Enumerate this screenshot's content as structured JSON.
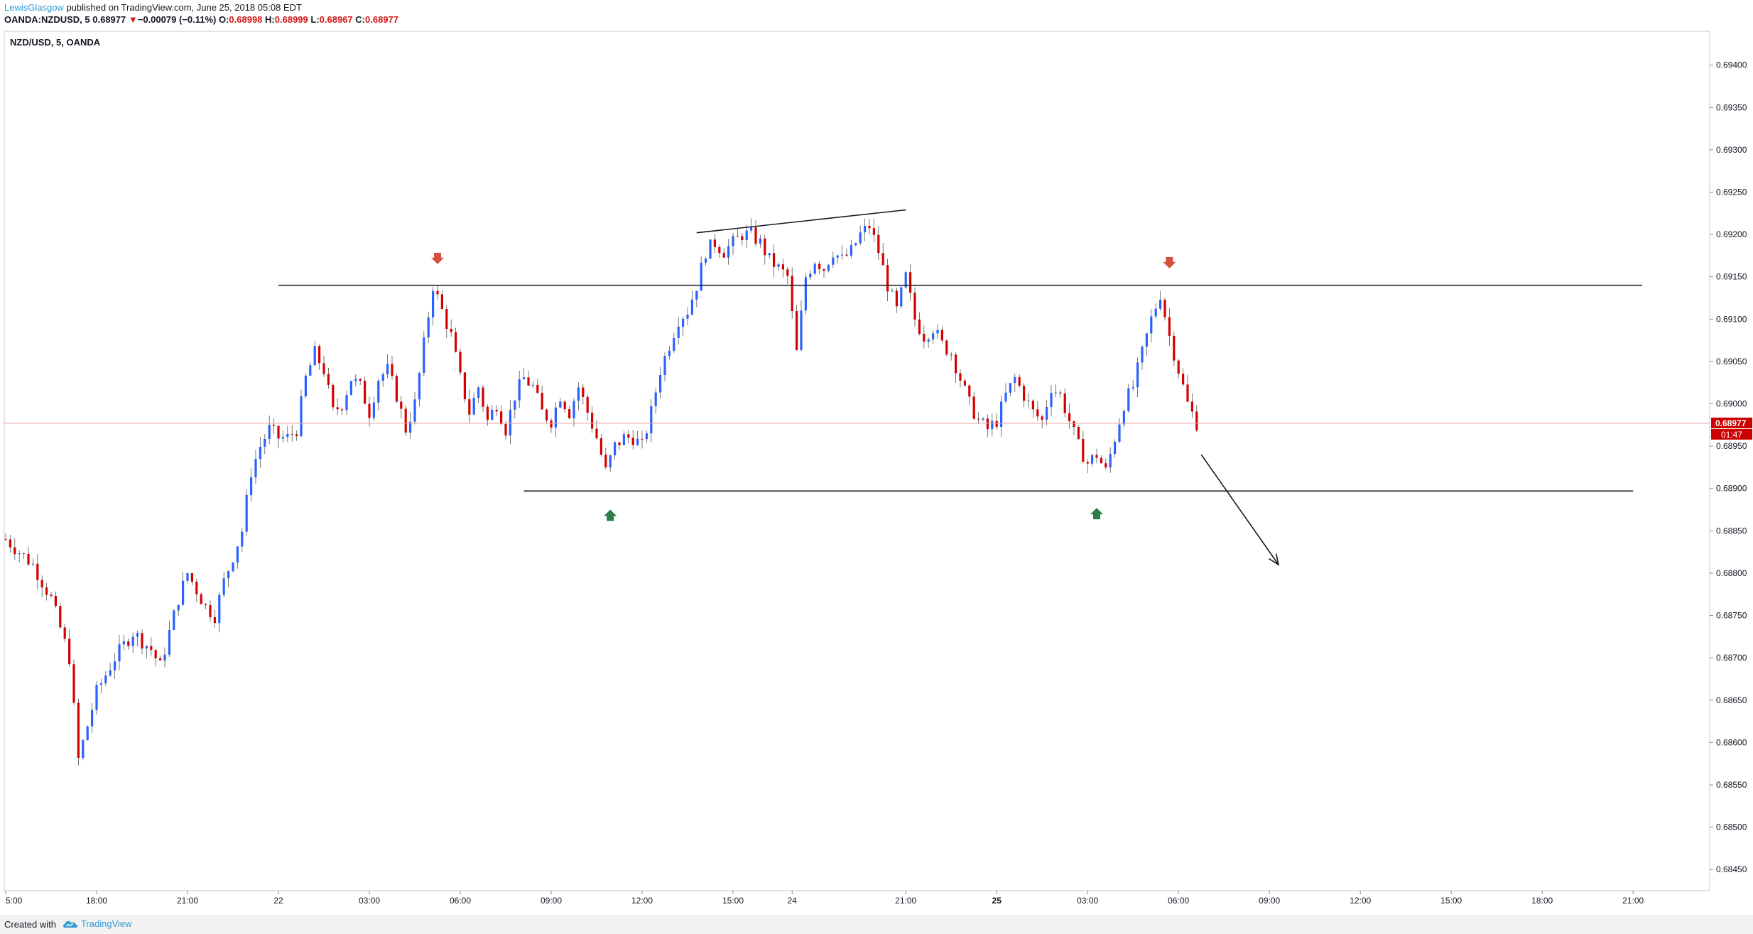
{
  "header": {
    "author": "LewisGlasgow",
    "published": " published on TradingView.com, June 25, 2018 05:08 EDT",
    "symbol": "OANDA:NZDUSD, 5",
    "last": "0.68977",
    "change_arrow": "▼",
    "change": "−0.00079 (−0.11%)",
    "o_label": "O:",
    "o": "0.68998",
    "h_label": "H:",
    "h": "0.68999",
    "l_label": "L:",
    "l": "0.68967",
    "c_label": "C:",
    "c": "0.68977"
  },
  "chart_title": "NZD/USD, 5, OANDA",
  "price_badge": {
    "price": "0.68977",
    "countdown": "01:47",
    "color": "#cc0000"
  },
  "colors": {
    "up": "#2962ff",
    "down": "#d50000",
    "axis": "#131722",
    "annotation_down": "#d1523c",
    "annotation_up": "#2e7d4a"
  },
  "footer": {
    "created_with": "Created with",
    "brand": "TradingView",
    "brand_icon": "tradingview-cloud-icon"
  },
  "chart_data": {
    "type": "candlestick",
    "y_axis": {
      "ylim": [
        0.68425,
        0.6944
      ],
      "ticks": [
        "0.69400",
        "0.69350",
        "0.69300",
        "0.69250",
        "0.69200",
        "0.69150",
        "0.69100",
        "0.69050",
        "0.69000",
        "0.68950",
        "0.68900",
        "0.68850",
        "0.68800",
        "0.68750",
        "0.68700",
        "0.68650",
        "0.68600",
        "0.68550",
        "0.68500",
        "0.68450"
      ]
    },
    "x_axis": {
      "ticks": [
        {
          "label": "5:00",
          "bar": 0,
          "bold": false
        },
        {
          "label": "18:00",
          "bar": 20,
          "bold": false
        },
        {
          "label": "21:00",
          "bar": 40,
          "bold": false
        },
        {
          "label": "22",
          "bar": 60,
          "bold": false
        },
        {
          "label": "03:00",
          "bar": 80,
          "bold": false
        },
        {
          "label": "06:00",
          "bar": 100,
          "bold": false
        },
        {
          "label": "09:00",
          "bar": 120,
          "bold": false
        },
        {
          "label": "12:00",
          "bar": 140,
          "bold": false
        },
        {
          "label": "15:00",
          "bar": 160,
          "bold": false
        },
        {
          "label": "24",
          "bar": 173,
          "bold": false
        },
        {
          "label": "21:00",
          "bar": 198,
          "bold": false
        },
        {
          "label": "25",
          "bar": 218,
          "bold": true
        },
        {
          "label": "03:00",
          "bar": 238,
          "bold": false
        },
        {
          "label": "06:00",
          "bar": 258,
          "bold": false
        },
        {
          "label": "09:00",
          "bar": 278,
          "bold": false
        },
        {
          "label": "12:00",
          "bar": 298,
          "bold": false
        },
        {
          "label": "15:00",
          "bar": 318,
          "bold": false
        },
        {
          "label": "18:00",
          "bar": 338,
          "bold": false
        },
        {
          "label": "21:00",
          "bar": 358,
          "bold": false
        }
      ]
    },
    "close_path": [
      [
        0,
        0.6884
      ],
      [
        6,
        0.6881
      ],
      [
        10,
        0.6877
      ],
      [
        14,
        0.687
      ],
      [
        16,
        0.6858
      ],
      [
        18,
        0.6862
      ],
      [
        20,
        0.6866
      ],
      [
        24,
        0.687
      ],
      [
        28,
        0.6873
      ],
      [
        32,
        0.6871
      ],
      [
        34,
        0.6869
      ],
      [
        38,
        0.6877
      ],
      [
        40,
        0.688
      ],
      [
        44,
        0.6876
      ],
      [
        46,
        0.6875
      ],
      [
        48,
        0.6879
      ],
      [
        50,
        0.6882
      ],
      [
        52,
        0.6885
      ],
      [
        54,
        0.6892
      ],
      [
        56,
        0.6895
      ],
      [
        58,
        0.6897
      ],
      [
        60,
        0.6896
      ],
      [
        62,
        0.6896
      ],
      [
        64,
        0.6897
      ],
      [
        66,
        0.6903
      ],
      [
        68,
        0.6906
      ],
      [
        70,
        0.6904
      ],
      [
        72,
        0.6899
      ],
      [
        74,
        0.69
      ],
      [
        76,
        0.6903
      ],
      [
        78,
        0.6902
      ],
      [
        80,
        0.6899
      ],
      [
        82,
        0.6903
      ],
      [
        84,
        0.6904
      ],
      [
        86,
        0.6901
      ],
      [
        88,
        0.6897
      ],
      [
        90,
        0.69
      ],
      [
        92,
        0.6907
      ],
      [
        94,
        0.6914
      ],
      [
        96,
        0.6911
      ],
      [
        98,
        0.6908
      ],
      [
        100,
        0.6903
      ],
      [
        102,
        0.6899
      ],
      [
        104,
        0.6902
      ],
      [
        106,
        0.6898
      ],
      [
        108,
        0.69
      ],
      [
        110,
        0.6897
      ],
      [
        112,
        0.6901
      ],
      [
        114,
        0.6903
      ],
      [
        116,
        0.6902
      ],
      [
        118,
        0.6899
      ],
      [
        120,
        0.6898
      ],
      [
        122,
        0.6901
      ],
      [
        124,
        0.6899
      ],
      [
        126,
        0.6902
      ],
      [
        128,
        0.6899
      ],
      [
        130,
        0.6896
      ],
      [
        132,
        0.6892
      ],
      [
        134,
        0.6895
      ],
      [
        136,
        0.6896
      ],
      [
        138,
        0.6896
      ],
      [
        140,
        0.6895
      ],
      [
        142,
        0.6899
      ],
      [
        144,
        0.6904
      ],
      [
        146,
        0.6907
      ],
      [
        148,
        0.691
      ],
      [
        150,
        0.6911
      ],
      [
        152,
        0.6914
      ],
      [
        154,
        0.6918
      ],
      [
        156,
        0.6919
      ],
      [
        158,
        0.6918
      ],
      [
        160,
        0.6919
      ],
      [
        162,
        0.692
      ],
      [
        164,
        0.692
      ],
      [
        166,
        0.6919
      ],
      [
        168,
        0.6917
      ],
      [
        170,
        0.6916
      ],
      [
        172,
        0.6915
      ],
      [
        174,
        0.6906
      ],
      [
        176,
        0.6915
      ],
      [
        178,
        0.6917
      ],
      [
        180,
        0.6916
      ],
      [
        182,
        0.6918
      ],
      [
        184,
        0.6917
      ],
      [
        186,
        0.6918
      ],
      [
        188,
        0.692
      ],
      [
        190,
        0.6921
      ],
      [
        192,
        0.6918
      ],
      [
        194,
        0.6914
      ],
      [
        196,
        0.6911
      ],
      [
        198,
        0.6915
      ],
      [
        200,
        0.691
      ],
      [
        202,
        0.6908
      ],
      [
        204,
        0.6909
      ],
      [
        206,
        0.6907
      ],
      [
        208,
        0.6906
      ],
      [
        210,
        0.6903
      ],
      [
        212,
        0.69
      ],
      [
        214,
        0.6898
      ],
      [
        216,
        0.6897
      ],
      [
        218,
        0.6898
      ],
      [
        220,
        0.6901
      ],
      [
        222,
        0.6903
      ],
      [
        224,
        0.6901
      ],
      [
        226,
        0.6899
      ],
      [
        228,
        0.6898
      ],
      [
        230,
        0.6902
      ],
      [
        232,
        0.6901
      ],
      [
        234,
        0.6898
      ],
      [
        236,
        0.6895
      ],
      [
        238,
        0.6893
      ],
      [
        240,
        0.6894
      ],
      [
        242,
        0.6892
      ],
      [
        244,
        0.6896
      ],
      [
        246,
        0.69
      ],
      [
        248,
        0.6902
      ],
      [
        250,
        0.6906
      ],
      [
        252,
        0.691
      ],
      [
        254,
        0.6913
      ],
      [
        256,
        0.6908
      ],
      [
        258,
        0.6904
      ],
      [
        260,
        0.69
      ],
      [
        262,
        0.68977
      ]
    ],
    "annotations": [
      {
        "type": "horizontal-line",
        "price": 0.6914,
        "from_bar": 60,
        "to_bar": 360
      },
      {
        "type": "horizontal-line",
        "price": 0.68897,
        "from_bar": 114,
        "to_bar": 358
      },
      {
        "type": "trend-line",
        "from": [
          152,
          0.69202
        ],
        "to": [
          198,
          0.69229
        ]
      },
      {
        "type": "arrow-down-marker",
        "bar": 95,
        "price": 0.6917
      },
      {
        "type": "arrow-down-marker",
        "bar": 256,
        "price": 0.69165
      },
      {
        "type": "arrow-up-marker",
        "bar": 133,
        "price": 0.6887
      },
      {
        "type": "arrow-up-marker",
        "bar": 240,
        "price": 0.68872
      },
      {
        "type": "projection-arrow",
        "from": [
          263,
          0.6894
        ],
        "to": [
          280,
          0.6881
        ]
      }
    ],
    "current_price_line": 0.68977
  }
}
